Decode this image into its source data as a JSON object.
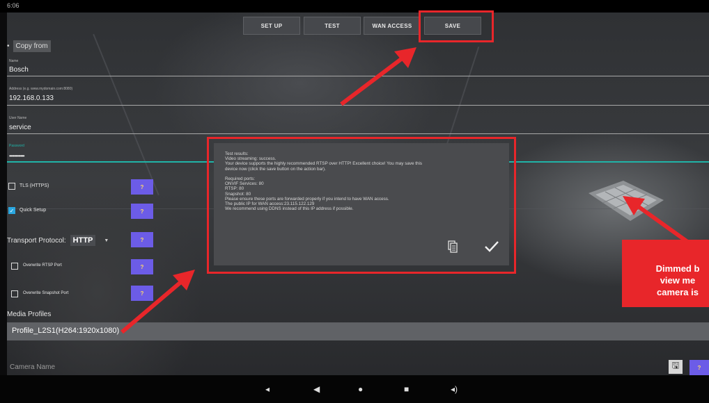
{
  "status_bar": {
    "time": "6:06",
    "right": ""
  },
  "action_bar": {
    "tabs": [
      {
        "label": "SET UP"
      },
      {
        "label": "TEST"
      },
      {
        "label": "WAN ACCESS"
      },
      {
        "label": "SAVE"
      }
    ]
  },
  "form": {
    "copy_from": "Copy from",
    "name_label": "Name",
    "name_value": "Bosch",
    "address_label": "Address (e.g. www.mydomain.com:8080)",
    "address_value": "192.168.0.133",
    "user_label": "User Name",
    "user_value": "service",
    "password_label": "Password",
    "password_value": "••••••••••••",
    "tls_label": "TLS (HTTPS)",
    "quick_setup_label": "Quick Setup",
    "transport_label": "Transport Protocol:",
    "transport_value": "HTTP",
    "overwrite_rtsp_label": "Overwrite RTSP Port",
    "overwrite_snapshot_label": "Overwrite Snapshot Port",
    "help_label": "?",
    "media_profiles_label": "Media Profiles",
    "media_profile_value": "Profile_L2S1(H264:1920x1080)",
    "camera_name_placeholder": "Camera Name"
  },
  "dialog": {
    "lines": [
      "Test results:",
      "Video streaming: success.",
      "Your device supports the highly recommended RTSP over HTTP! Excellent choice! You may save this",
      "device now (click the save button on the action bar).",
      "",
      "Required ports:",
      "ONVIF Services: 80",
      "RTSP: 80",
      "Snapshot: 80",
      "Please ensure these ports are forwarded properly if you intend to have WAN access.",
      "The public IP for WAN access:23.115.122.129",
      "We recommend using DDNS instead of this IP address if possible."
    ]
  },
  "callout": {
    "text": "Dimmed b\nview me\ncamera is"
  },
  "colors": {
    "highlight": "#e8262a",
    "help_button": "#6c5ce7",
    "checkbox_checked": "#2aa7e0"
  },
  "icons": [
    "copy-icon",
    "check-icon",
    "floppy-save-icon",
    "volume-down-icon",
    "back-icon",
    "home-icon",
    "recents-icon",
    "volume-up-icon"
  ]
}
